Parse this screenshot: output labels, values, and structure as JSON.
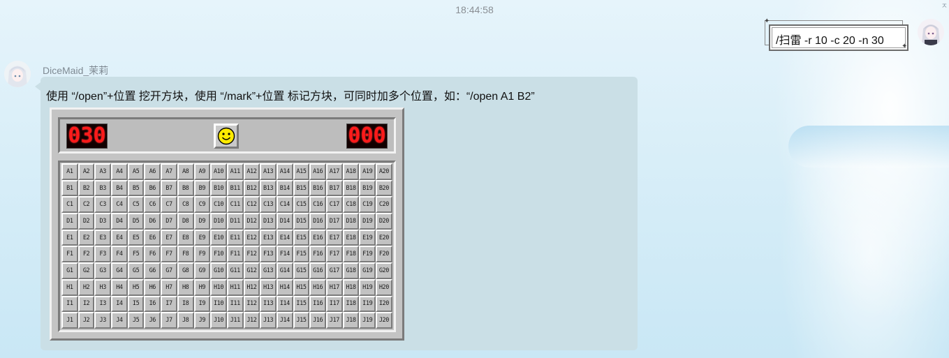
{
  "timestamp": "18:44:58",
  "user_message": {
    "text": "/扫雷 -r 10 -c 20 -n 30"
  },
  "bot": {
    "name": "DiceMaid_茉莉",
    "message": "使用 “/open”+位置 挖开方块，使用 “/mark”+位置 标记方块，可同时加多个位置，如：“/open A1 B2”"
  },
  "minesweeper": {
    "mine_counter": "030",
    "timer": "000",
    "rows": [
      "A",
      "B",
      "C",
      "D",
      "E",
      "F",
      "G",
      "H",
      "I",
      "J"
    ],
    "columns": 20,
    "colors": {
      "led": "#ff1a1a",
      "led_bg": "#120000",
      "face": "#ffeb00",
      "tile": "#c2c2c2"
    }
  },
  "icons": {
    "face_button": "smiley-face-icon"
  }
}
